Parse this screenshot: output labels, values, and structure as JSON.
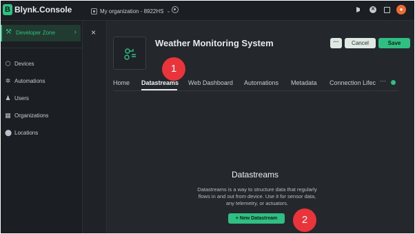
{
  "app": {
    "logo_letter": "B",
    "name": "Blynk.Console"
  },
  "topbar": {
    "org_name": "My organization - 8922HS",
    "org_chevron": "⌄",
    "avatar_initial": "●"
  },
  "sidebar": {
    "developer_zone": {
      "label": "Developer Zone",
      "icon": "tools-icon",
      "chevron": "›"
    },
    "items": [
      {
        "label": "Devices",
        "icon": "cube-icon"
      },
      {
        "label": "Automations",
        "icon": "automation-icon"
      },
      {
        "label": "Users",
        "icon": "users-icon"
      },
      {
        "label": "Organizations",
        "icon": "building-icon"
      },
      {
        "label": "Locations",
        "icon": "pin-icon"
      }
    ]
  },
  "close_glyph": "×",
  "template": {
    "title": "Weather Monitoring System"
  },
  "actions": {
    "more": "···",
    "cancel": "Cancel",
    "save": "Save"
  },
  "tabs": [
    "Home",
    "Datastreams",
    "Web Dashboard",
    "Automations",
    "Metadata",
    "Connection Lifec"
  ],
  "active_tab": "Datastreams",
  "tab_overflow": "···",
  "annotations": {
    "badge_1": "1",
    "badge_2": "2"
  },
  "empty_state": {
    "title": "Datastreams",
    "description": "Datastreams is a way to structure data that regularly flows in and out from device. Use it for sensor data, any telemetry, or actuators.",
    "button": "+ New Datastream"
  },
  "colors": {
    "accent": "#2fbf83",
    "badge": "#e8343a",
    "background": "#1f2327"
  }
}
